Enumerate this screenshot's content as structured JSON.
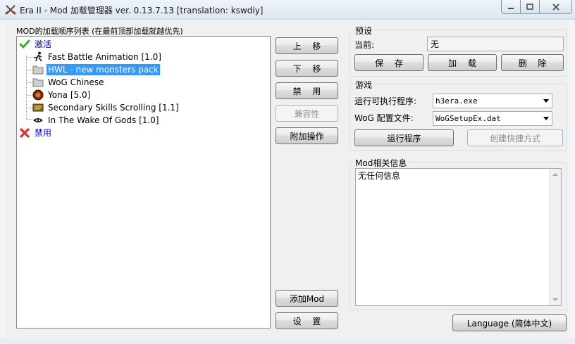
{
  "window": {
    "title": "Era II - Mod 加载管理器 ver. 0.13.7.13 [translation: kswdiy]",
    "controls": {
      "minimize": "minimize",
      "maximize": "maximize",
      "close": "close"
    }
  },
  "mods": {
    "list_label": "MOD的加载顺序列表 (在最前顶部加载就越优先)",
    "groups": {
      "active": {
        "label": "激活",
        "icon": "check-icon"
      },
      "disabled": {
        "label": "禁用",
        "icon": "cross-icon"
      }
    },
    "items": [
      {
        "label": "Fast Battle Animation [1.0]",
        "icon": "running-man-icon"
      },
      {
        "label": "HWL - new monsters pack",
        "icon": "folder-icon",
        "selected": true
      },
      {
        "label": "WoG Chinese",
        "icon": "folder-icon"
      },
      {
        "label": "Yona [5.0]",
        "icon": "orb-icon"
      },
      {
        "label": "Secondary Skills Scrolling [1.1]",
        "icon": "scroll-icon"
      },
      {
        "label": "In The Wake Of Gods [1.0]",
        "icon": "mask-icon"
      }
    ]
  },
  "actions": {
    "move_up": "上 移",
    "move_down": "下 移",
    "disable": "禁 用",
    "compatibility": "兼容性",
    "extra_ops": "附加操作",
    "add_mod": "添加Mod",
    "settings": "设 置"
  },
  "preset": {
    "title": "预设",
    "current_label": "当前:",
    "current_value": "无",
    "save": "保 存",
    "load": "加 载",
    "delete": "删 除"
  },
  "game": {
    "title": "游戏",
    "exe_label": "运行可执行程序:",
    "exe_value": "h3era.exe",
    "config_label": "WoG 配置文件:",
    "config_value": "WoGSetupEx.dat",
    "run": "运行程序",
    "shortcut": "创建快捷方式"
  },
  "info": {
    "title": "Mod相关信息",
    "text": "无任何信息"
  },
  "language_button": "Language (简体中文)",
  "colors": {
    "selection": "#3399ff",
    "group_text": "#0000cc",
    "check": "#3aa832",
    "cross": "#d9302c"
  }
}
